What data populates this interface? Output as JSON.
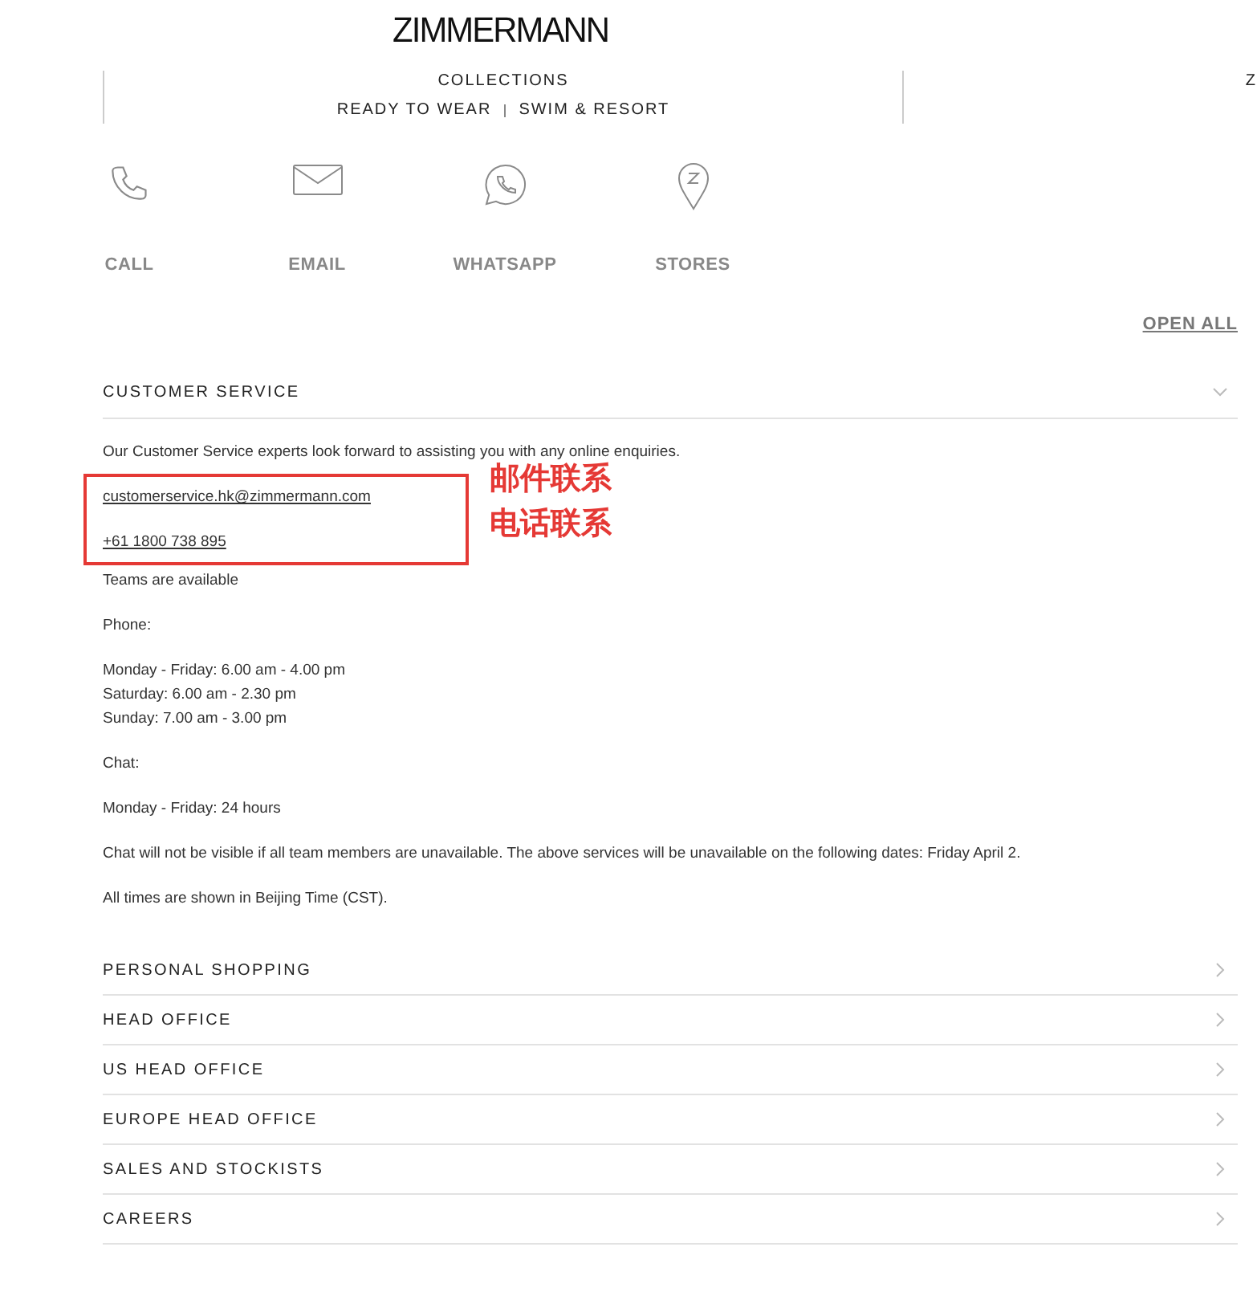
{
  "logo": "ZIMMERMANN",
  "nav": [
    {
      "heading": "COLLECTIONS",
      "links": [
        "READY TO WEAR",
        "SWIM & RESORT"
      ]
    },
    {
      "heading": "Z"
    }
  ],
  "contact_options": [
    {
      "kind": "phone",
      "label": "CALL"
    },
    {
      "kind": "email",
      "label": "EMAIL"
    },
    {
      "kind": "whatsapp",
      "label": "WHATSAPP"
    },
    {
      "kind": "stores",
      "label": "STORES"
    }
  ],
  "open_all": "OPEN ALL",
  "sections": [
    {
      "title": "CUSTOMER SERVICE",
      "expanded": true,
      "intro": "Our Customer Service experts look forward to assisting you with any online enquiries.",
      "links": [
        {
          "text": "customerservice.hk@zimmermann.com",
          "annotation": "邮件联系"
        },
        {
          "text": "+61 1800 738 895",
          "annotation": "电话联系"
        }
      ],
      "paragraphs": [
        [
          "Teams are available"
        ],
        [
          "Phone:"
        ],
        [
          "Monday - Friday: 6.00 am - 4.00 pm",
          "Saturday: 6.00 am - 2.30 pm",
          "Sunday: 7.00 am - 3.00 pm"
        ],
        [
          "Chat:"
        ],
        [
          "Monday - Friday: 24 hours"
        ],
        [
          "Chat will not be visible if all team members are unavailable. The above services will be unavailable on the following dates: Friday April 2."
        ],
        [
          "All times are shown in Beijing Time (CST)."
        ]
      ]
    },
    {
      "title": "PERSONAL SHOPPING",
      "expanded": false
    },
    {
      "title": "HEAD OFFICE",
      "expanded": false
    },
    {
      "title": "US HEAD OFFICE",
      "expanded": false
    },
    {
      "title": "EUROPE HEAD OFFICE",
      "expanded": false
    },
    {
      "title": "SALES AND STOCKISTS",
      "expanded": false
    },
    {
      "title": "CAREERS",
      "expanded": false
    }
  ]
}
